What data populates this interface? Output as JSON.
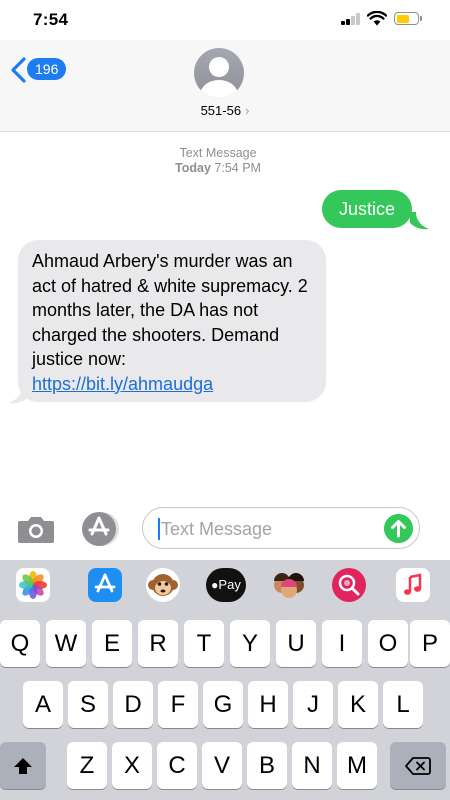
{
  "status_bar": {
    "time": "7:54"
  },
  "header": {
    "back_count": "196",
    "contact": "551-56",
    "contact_chevron": "›"
  },
  "conversation": {
    "meta_label": "Text Message",
    "meta_day": "Today",
    "meta_time": "7:54 PM",
    "outgoing": "Justice",
    "incoming_text": "Ahmaud Arbery's murder was an act of hatred & white supremacy. 2 months later, the DA has not charged the shooters. Demand justice now: ",
    "incoming_link": "https://bit.ly/ahmaudga"
  },
  "input": {
    "placeholder": "Text Message"
  },
  "app_strip": {
    "icons": [
      "photos-icon",
      "app-store-icon",
      "animoji-icon",
      "apple-pay-icon",
      "memoji-icon",
      "images-search-icon",
      "music-icon"
    ],
    "apple_pay_label": "Pay"
  },
  "keyboard": {
    "row1": [
      "Q",
      "W",
      "E",
      "R",
      "T",
      "Y",
      "U",
      "I",
      "O",
      "P"
    ],
    "row2": [
      "A",
      "S",
      "D",
      "F",
      "G",
      "H",
      "J",
      "K",
      "L"
    ],
    "row3": [
      "Z",
      "X",
      "C",
      "V",
      "B",
      "N",
      "M"
    ]
  },
  "colors": {
    "imessage_blue": "#1e7cf2",
    "sms_green": "#34c759",
    "incoming_bubble": "#e9e9eb",
    "keyboard_bg": "#d1d3d9"
  }
}
